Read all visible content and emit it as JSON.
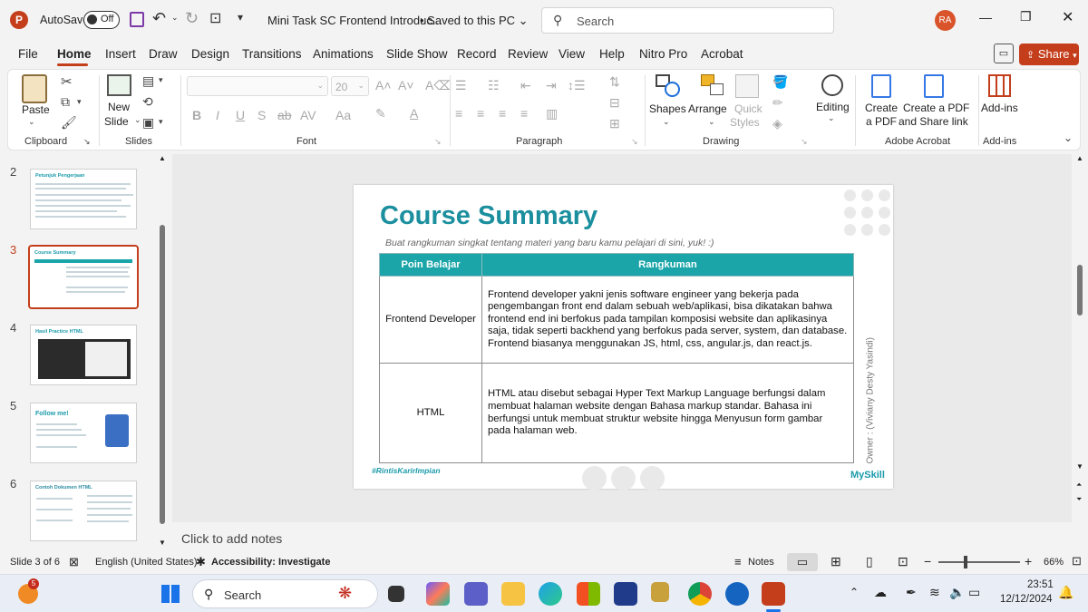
{
  "titlebar": {
    "autosave_label": "AutoSave",
    "autosave_state": "Off",
    "doc_title": "Mini Task SC Frontend Introduc...",
    "save_status": "Saved to this PC",
    "search_placeholder": "Search",
    "user_initials": "RA"
  },
  "tabs": [
    "File",
    "Home",
    "Insert",
    "Draw",
    "Design",
    "Transitions",
    "Animations",
    "Slide Show",
    "Record",
    "Review",
    "View",
    "Help",
    "Nitro Pro",
    "Acrobat"
  ],
  "share_label": "Share",
  "ribbon": {
    "paste": "Paste",
    "clipboard": "Clipboard",
    "new_slide_1": "New",
    "new_slide_2": "Slide",
    "slides": "Slides",
    "font_size": "20",
    "font": "Font",
    "paragraph": "Paragraph",
    "shapes": "Shapes",
    "arrange": "Arrange",
    "quick_styles_1": "Quick",
    "quick_styles_2": "Styles",
    "drawing": "Drawing",
    "editing": "Editing",
    "create_pdf_1": "Create",
    "create_pdf_2": "a PDF",
    "create_share_1": "Create a PDF",
    "create_share_2": "and Share link",
    "adobe_acrobat": "Adobe Acrobat",
    "addins_btn": "Add-ins",
    "addins": "Add-ins"
  },
  "thumbnails": [
    {
      "num": "2",
      "title": "Petunjuk Pengerjaan"
    },
    {
      "num": "3",
      "title": "Course Summary"
    },
    {
      "num": "4",
      "title": "Hasil Practice HTML"
    },
    {
      "num": "5",
      "title": "Follow me!"
    },
    {
      "num": "6",
      "title": "Contoh Dokumen HTML"
    }
  ],
  "slide": {
    "title": "Course Summary",
    "subtitle": "Buat rangkuman singkat tentang materi yang baru kamu pelajari di sini, yuk! :)",
    "table": {
      "headers": [
        "Poin Belajar",
        "Rangkuman"
      ],
      "rows": [
        {
          "point": "Frontend Developer",
          "summary": "Frontend developer yakni jenis software engineer yang bekerja pada pengembangan front end dalam sebuah web/aplikasi, bisa dikatakan bahwa frontend end ini berfokus pada tampilan komposisi website dan aplikasinya saja, tidak seperti backhend yang berfokus pada server, system, dan database. Frontend biasanya menggunakan JS, html, css, angular.js, dan react.js."
        },
        {
          "point": "HTML",
          "summary": "HTML atau disebut sebagai Hyper Text Markup Language berfungsi dalam membuat halaman website dengan Bahasa markup standar. Bahasa ini berfungsi untuk membuat struktur website hingga Menyusun form gambar pada halaman web."
        }
      ]
    },
    "owner": "Owner : (Viviany Desty Yasindi)",
    "hashtag": "#RintisKarirImpian",
    "brand": "MySkill"
  },
  "notes_placeholder": "Click to add notes",
  "status": {
    "slide_count": "Slide 3 of 6",
    "language": "English (United States)",
    "accessibility": "Accessibility: Investigate",
    "notes": "Notes",
    "zoom": "66%"
  },
  "taskbar": {
    "search": "Search",
    "time": "23:51",
    "date": "12/12/2024",
    "badge": "5"
  },
  "colors": {
    "accent": "#c43e1c",
    "teal": "#1ba5a9"
  }
}
